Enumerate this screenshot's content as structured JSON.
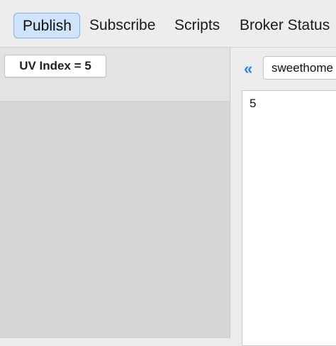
{
  "tabs": {
    "publish": "Publish",
    "subscribe": "Subscribe",
    "scripts": "Scripts",
    "broker_status": "Broker Status"
  },
  "left": {
    "topic_button_label": "UV Index = 5"
  },
  "right": {
    "collapse_icon": "«",
    "topic_value": "sweethome",
    "payload_text": "5"
  },
  "colors": {
    "accent": "#2f7fe0",
    "active_tab_bg": "#cfe3fb",
    "active_tab_border": "#7fb2ef"
  }
}
